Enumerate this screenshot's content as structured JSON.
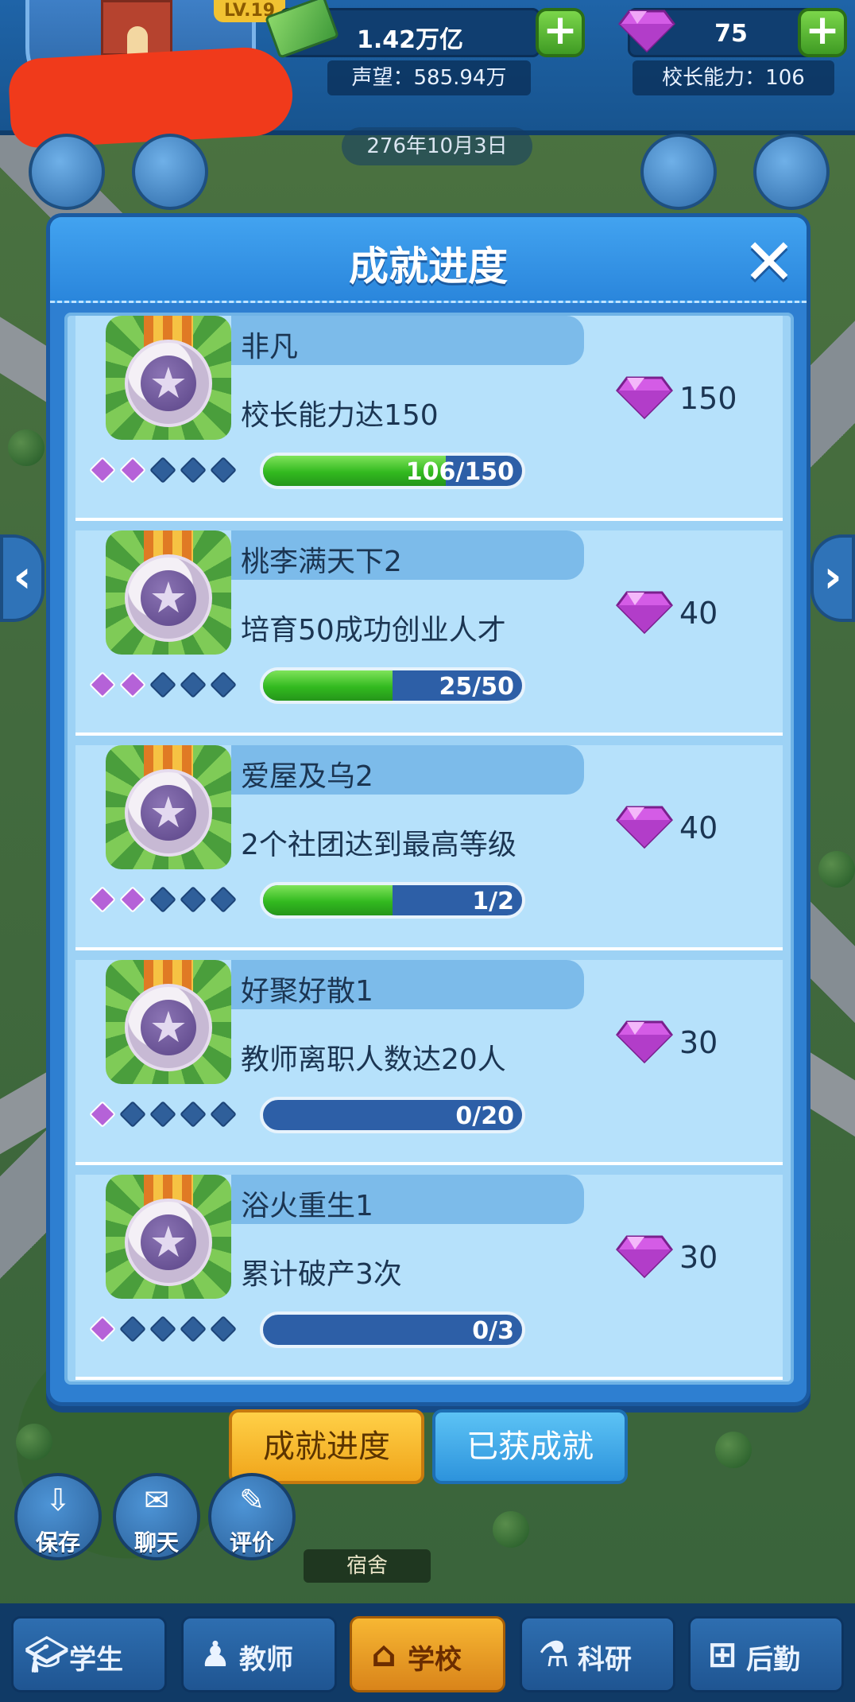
{
  "hud": {
    "level": "LV.19",
    "money": "1.42万亿",
    "gems": "75",
    "reputation": "声望：585.94万",
    "principal_ability": "校长能力：106",
    "plus_symbol": "+"
  },
  "date": "276年10月3日",
  "dialog": {
    "title": "成就进度",
    "close_symbol": "✕"
  },
  "colors": {
    "accent_blue": "#2e7fd1",
    "progress_green": "#32b91f",
    "gem_purple": "#c44ad8",
    "active_tab": "#f0a51b"
  },
  "achievements": [
    {
      "title": "非凡",
      "desc": "校长能力达150",
      "reward": "150",
      "progress_text": "106/150",
      "progress": 0.7067,
      "stars_on": 2,
      "stars_total": 5
    },
    {
      "title": "桃李满天下2",
      "desc": "培育50成功创业人才",
      "reward": "40",
      "progress_text": "25/50",
      "progress": 0.5,
      "stars_on": 2,
      "stars_total": 5
    },
    {
      "title": "爱屋及乌2",
      "desc": "2个社团达到最高等级",
      "reward": "40",
      "progress_text": "1/2",
      "progress": 0.5,
      "stars_on": 2,
      "stars_total": 5
    },
    {
      "title": "好聚好散1",
      "desc": "教师离职人数达20人",
      "reward": "30",
      "progress_text": "0/20",
      "progress": 0,
      "stars_on": 1,
      "stars_total": 5
    },
    {
      "title": "浴火重生1",
      "desc": "累计破产3次",
      "reward": "30",
      "progress_text": "0/3",
      "progress": 0,
      "stars_on": 1,
      "stars_total": 5
    }
  ],
  "tabs": {
    "progress": "成就进度",
    "obtained": "已获成就"
  },
  "quick_buttons": [
    {
      "label": "保存",
      "icon": "save-icon"
    },
    {
      "label": "聊天",
      "icon": "chat-icon"
    },
    {
      "label": "评价",
      "icon": "review-icon"
    }
  ],
  "map_label": "宿舍",
  "nav": [
    {
      "label": "学生",
      "icon": "graduation-cap-icon",
      "active": false
    },
    {
      "label": "教师",
      "icon": "teacher-icon",
      "active": false
    },
    {
      "label": "学校",
      "icon": "school-icon",
      "active": true
    },
    {
      "label": "科研",
      "icon": "microscope-icon",
      "active": false
    },
    {
      "label": "后勤",
      "icon": "logistics-icon",
      "active": false
    }
  ]
}
